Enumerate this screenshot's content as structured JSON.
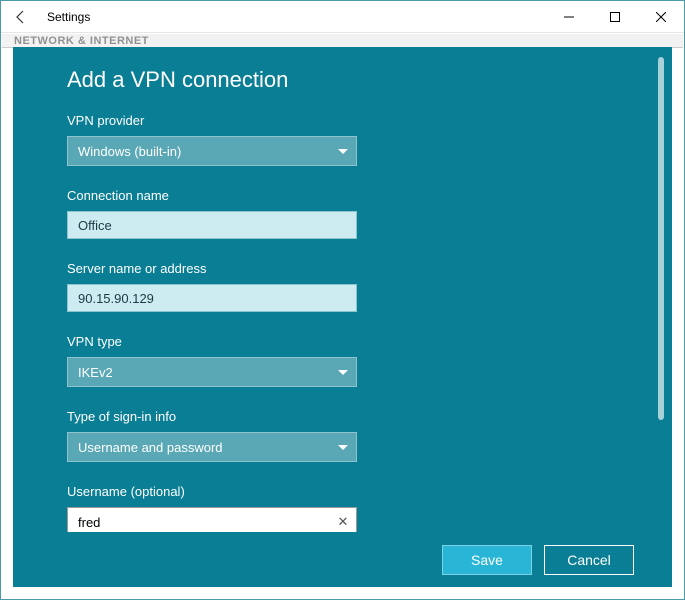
{
  "window": {
    "title": "Settings",
    "background_header": "NETWORK & INTERNET"
  },
  "dialog": {
    "title": "Add a VPN connection",
    "fields": {
      "provider_label": "VPN provider",
      "provider_value": "Windows (built-in)",
      "connection_label": "Connection name",
      "connection_value": "Office",
      "server_label": "Server name or address",
      "server_value": "90.15.90.129",
      "vpntype_label": "VPN type",
      "vpntype_value": "IKEv2",
      "signin_label": "Type of sign-in info",
      "signin_value": "Username and password",
      "username_label": "Username (optional)",
      "username_value": "fred"
    },
    "buttons": {
      "save": "Save",
      "cancel": "Cancel"
    }
  }
}
